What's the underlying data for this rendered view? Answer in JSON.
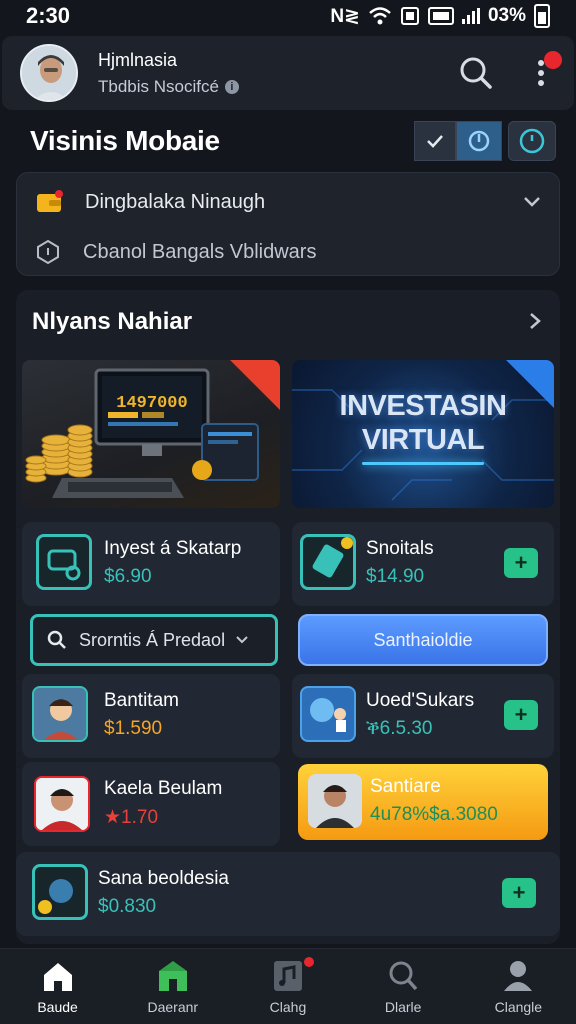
{
  "status_bar": {
    "time": "2:30",
    "indicators": "N≷",
    "battery": "03%"
  },
  "header": {
    "name": "Hjmlnasia",
    "subtitle": "Tbdbis Nsocifcé",
    "icons": [
      "avatar",
      "search-icon",
      "more-vertical-icon"
    ]
  },
  "page": {
    "title": "Visinis Mobaie"
  },
  "filters": [
    {
      "label": "Dingbalaka Ninaugh",
      "icon": "wallet-icon"
    },
    {
      "label": "Cbanol Bangals Vblidwars",
      "icon": "shield-icon"
    }
  ],
  "section": {
    "title": "Nlyans Nahiar",
    "banners": [
      {
        "label": "1497000",
        "icon": "coins-computer-image"
      },
      {
        "title_line1": "INVESTASIN",
        "title_line2": "VIRTUAL"
      }
    ],
    "cards": [
      {
        "title": "Inyest á Skatarp",
        "price": "$6.90",
        "icon": "piggy-icon"
      },
      {
        "title": "Snoitals",
        "price": "$14.90",
        "icon": "ticket-icon"
      },
      {
        "title": "Bantitam",
        "price": "$1.590",
        "icon": "avatar-photo"
      },
      {
        "title": "Uoed'Sukars",
        "price": "ቕ6.5.30",
        "icon": "robot-icon"
      },
      {
        "title": "Kaela Beulam",
        "price": "★1.70",
        "icon": "avatar-photo"
      },
      {
        "title": "Santiare",
        "price": "4u78%$a.3080",
        "icon": "avatar-photo"
      },
      {
        "title": "Sana beoldesia",
        "price": "$0.830",
        "icon": "globe-icon"
      }
    ],
    "search": {
      "label": "Srorntis Á Predaol"
    },
    "primary_button": "Santhaioldie"
  },
  "nav": [
    {
      "label": "Baude",
      "icon": "home-icon"
    },
    {
      "label": "Daeranr",
      "icon": "store-icon"
    },
    {
      "label": "Clahg",
      "icon": "music-icon"
    },
    {
      "label": "Dlarle",
      "icon": "search-icon"
    },
    {
      "label": "Clangle",
      "icon": "profile-icon"
    }
  ],
  "colors": {
    "accent_teal": "#38c1b8",
    "accent_green": "#27c28a",
    "accent_blue": "#3a74e8",
    "accent_yellow": "#f5a623",
    "alert_red": "#e8262d"
  }
}
